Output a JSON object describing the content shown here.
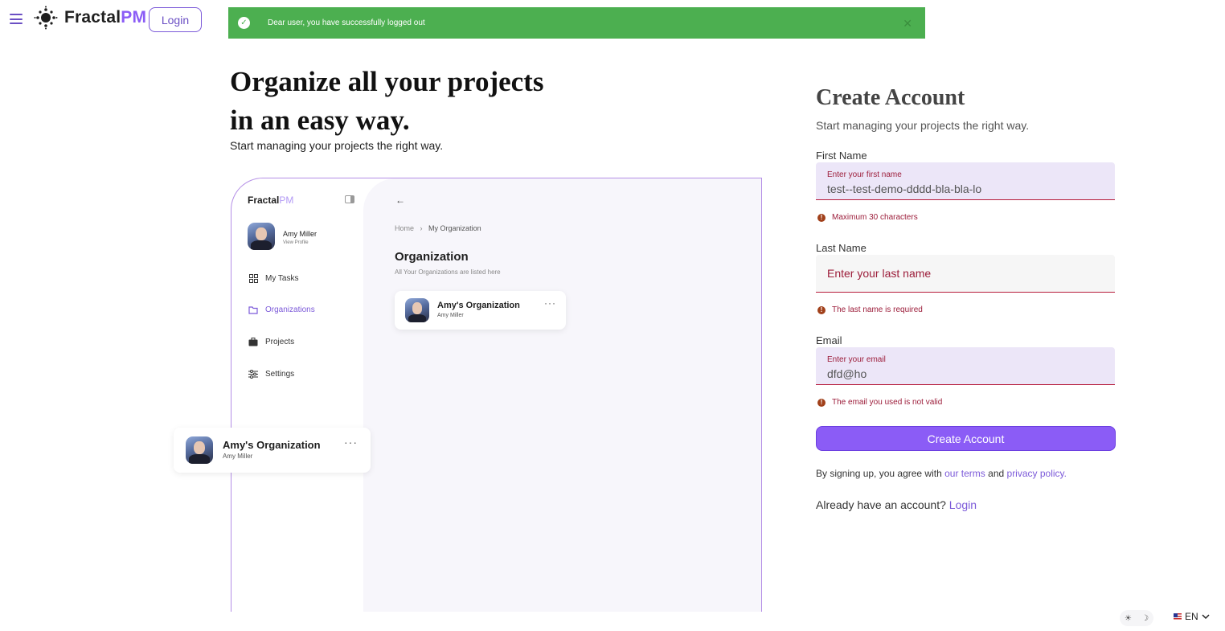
{
  "header": {
    "brand_name": "Fractal",
    "brand_suffix": "PM",
    "login_label": "Login"
  },
  "toast": {
    "message": "Dear user, you have successfully logged out",
    "close_symbol": "✕",
    "color": "#4caf50"
  },
  "hero": {
    "title_line1": "Organize all your projects",
    "title_line2": "in an easy way.",
    "subtitle": "Start managing your projects the right way."
  },
  "mockup": {
    "brand_name": "Fractal",
    "brand_suffix": "PM",
    "user_name": "Amy Miller",
    "user_link": "View Profile",
    "nav": [
      {
        "label": "My Tasks",
        "icon": "grid-icon"
      },
      {
        "label": "Organizations",
        "icon": "folder-icon",
        "active": true
      },
      {
        "label": "Projects",
        "icon": "briefcase-icon"
      },
      {
        "label": "Settings",
        "icon": "sliders-icon"
      }
    ],
    "breadcrumb_home": "Home",
    "breadcrumb_sep": "›",
    "breadcrumb_current": "My Organization",
    "heading": "Organization",
    "heading_sub": "All Your Organizations are listed here",
    "card": {
      "name": "Amy's Organization",
      "owner": "Amy Miller"
    }
  },
  "floating_card": {
    "name": "Amy's Organization",
    "owner": "Amy Miller"
  },
  "form": {
    "title": "Create Account",
    "subtitle": "Start managing your projects the right way.",
    "first_name": {
      "label": "First Name",
      "float_label": "Enter your first name",
      "value": "test--test-demo-dddd-bla-bla-lo",
      "error": "Maximum 30 characters"
    },
    "last_name": {
      "label": "Last Name",
      "placeholder": "Enter your last name",
      "error": "The last name is required"
    },
    "email": {
      "label": "Email",
      "float_label": "Enter your email",
      "value": "dfd@ho",
      "error": "The email you used is not valid"
    },
    "submit_label": "Create Account",
    "terms_prefix": "By signing up, you agree with",
    "terms_link": "our terms",
    "terms_and": "and",
    "privacy_link": "privacy policy.",
    "already_text": "Already have an account?",
    "already_link": "Login",
    "accent_color": "#8b5cf6",
    "error_color": "#9c1d3a"
  },
  "footer": {
    "theme_light_icon": "☀",
    "theme_dark_icon": "☽",
    "language": "EN"
  }
}
